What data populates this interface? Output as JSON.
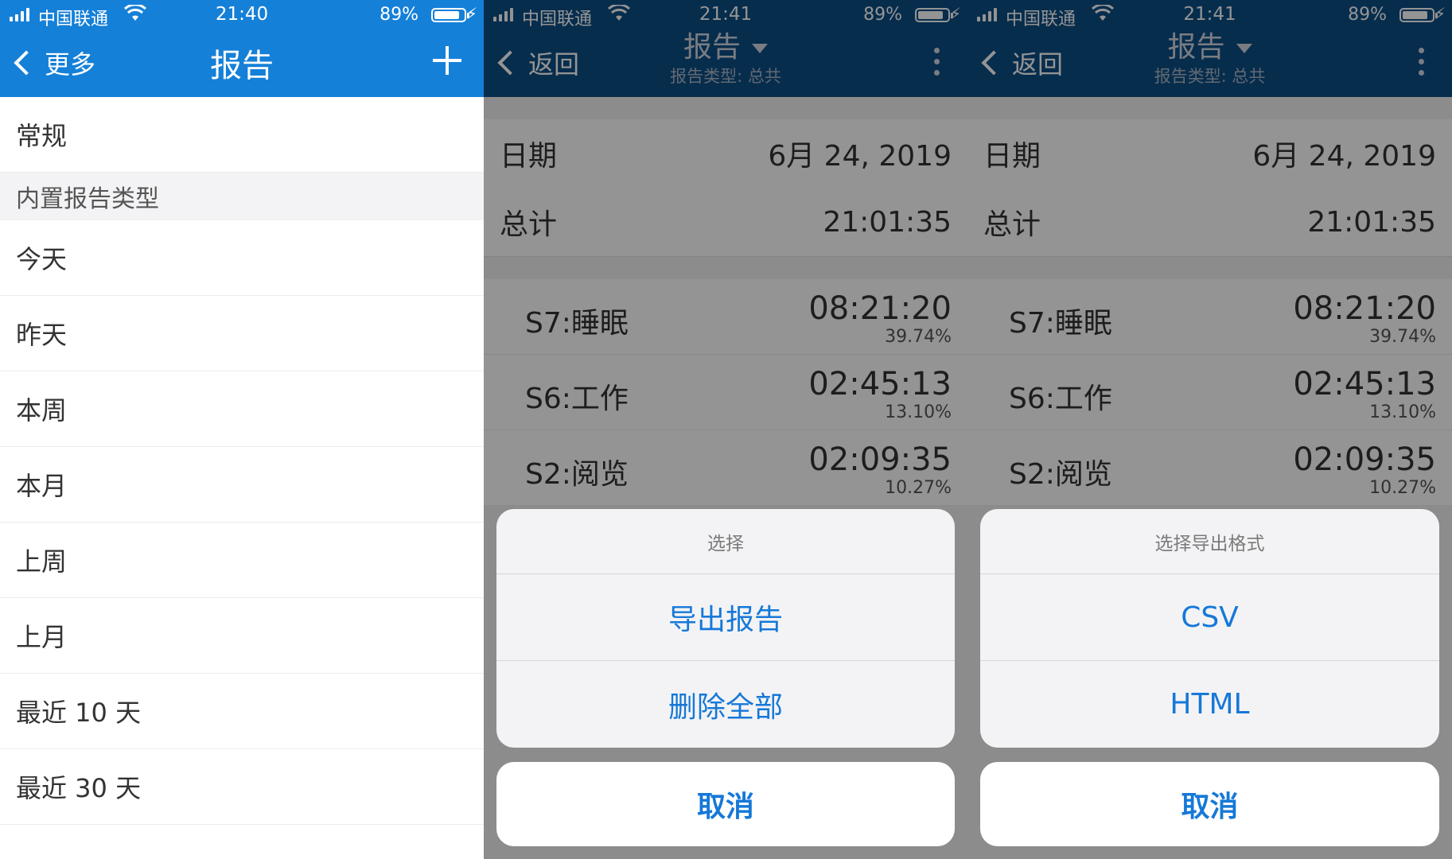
{
  "screens": [
    {
      "status": {
        "carrier": "中国联通",
        "time": "21:40",
        "battery": "89%"
      },
      "nav": {
        "back_label": "更多",
        "title": "报告"
      },
      "list": {
        "top_item": "常规",
        "section_header": "内置报告类型",
        "items": [
          "今天",
          "昨天",
          "本周",
          "本月",
          "上周",
          "上月",
          "最近 10 天",
          "最近 30 天"
        ]
      }
    },
    {
      "status": {
        "carrier": "中国联通",
        "time": "21:41",
        "battery": "89%"
      },
      "nav": {
        "back_label": "返回",
        "title": "报告",
        "subtitle": "报告类型: 总共"
      },
      "summary": {
        "date_label": "日期",
        "date_value": "6月 24, 2019",
        "total_label": "总计",
        "total_value": "21:01:35"
      },
      "entries": [
        {
          "name": "S7:睡眠",
          "duration": "08:21:20",
          "percent": "39.74%"
        },
        {
          "name": "S6:工作",
          "duration": "02:45:13",
          "percent": "13.10%"
        },
        {
          "name": "S2:阅览",
          "duration": "02:09:35",
          "percent": "10.27%"
        }
      ],
      "sheet": {
        "title": "选择",
        "options": [
          "导出报告",
          "删除全部"
        ],
        "cancel": "取消"
      }
    },
    {
      "status": {
        "carrier": "中国联通",
        "time": "21:41",
        "battery": "89%"
      },
      "nav": {
        "back_label": "返回",
        "title": "报告",
        "subtitle": "报告类型: 总共"
      },
      "summary": {
        "date_label": "日期",
        "date_value": "6月 24, 2019",
        "total_label": "总计",
        "total_value": "21:01:35"
      },
      "entries": [
        {
          "name": "S7:睡眠",
          "duration": "08:21:20",
          "percent": "39.74%"
        },
        {
          "name": "S6:工作",
          "duration": "02:45:13",
          "percent": "13.10%"
        },
        {
          "name": "S2:阅览",
          "duration": "02:09:35",
          "percent": "10.27%"
        }
      ],
      "sheet": {
        "title": "选择导出格式",
        "options": [
          "CSV",
          "HTML"
        ],
        "cancel": "取消"
      }
    }
  ],
  "colors": {
    "nav_blue": "#1580d8",
    "nav_dark": "#0d4f86",
    "accent": "#1678d8"
  },
  "icons": [
    "signal-icon",
    "wifi-icon",
    "battery-icon",
    "charging-icon",
    "back-chevron-icon",
    "plus-icon",
    "more-vertical-icon",
    "dropdown-caret-icon"
  ]
}
